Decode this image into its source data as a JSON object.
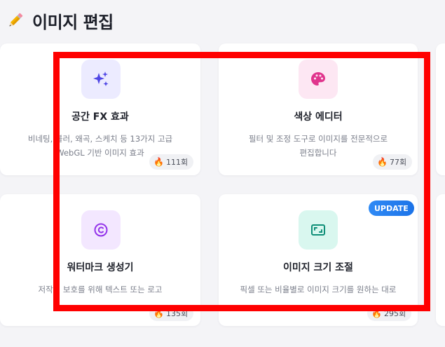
{
  "header": {
    "title": "이미지 편집",
    "icon": "pencil-icon"
  },
  "cards": [
    {
      "title": "공간 FX 효과",
      "desc": "비네팅, 블러, 왜곡, 스케치 등 13가지 고급\nWebGL 기반 이미지 효과",
      "count": "111회",
      "icon": "sparkles-icon",
      "icon_bg": "#ecebff",
      "icon_color": "#4f46e5"
    },
    {
      "title": "색상 에디터",
      "desc": "필터 및 조정 도구로 이미지를 전문적으로\n편집합니다",
      "count": "77회",
      "icon": "palette-icon",
      "icon_bg": "#fde7f3",
      "icon_color": "#e0358d"
    },
    {
      "title": "워터마크 생성기",
      "desc": "저작권 보호를 위해 텍스트 또는 로고",
      "count": "135회",
      "icon": "copyright-icon",
      "icon_bg": "#f3e7ff",
      "icon_color": "#9333ea"
    },
    {
      "title": "이미지 크기 조절",
      "desc": "픽셀 또는 비율별로 이미지 크기를 원하는 대로",
      "count": "295회",
      "icon": "resize-icon",
      "icon_bg": "#d9f7ef",
      "icon_color": "#0f8f78",
      "badge": "UPDATE"
    }
  ],
  "colors": {
    "highlight": "#ff0000",
    "badge": "#1c73e8"
  }
}
